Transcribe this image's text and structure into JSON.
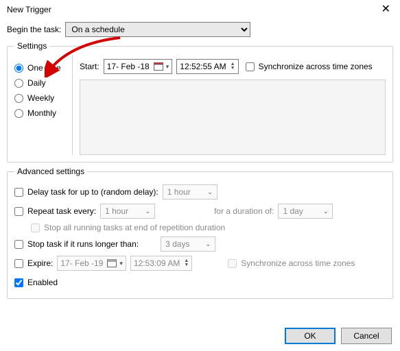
{
  "window": {
    "title": "New Trigger"
  },
  "begin": {
    "label": "Begin the task:",
    "selected": "On a schedule"
  },
  "settings": {
    "legend": "Settings",
    "radios": {
      "one_time": "One time",
      "daily": "Daily",
      "weekly": "Weekly",
      "monthly": "Monthly"
    },
    "start_label": "Start:",
    "date": "17- Feb -18",
    "time": "12:52:55 AM",
    "sync_label": "Synchronize across time zones"
  },
  "advanced": {
    "legend": "Advanced settings",
    "delay_label": "Delay task for up to (random delay):",
    "delay_value": "1 hour",
    "repeat_label": "Repeat task every:",
    "repeat_value": "1 hour",
    "duration_label": "for a duration of:",
    "duration_value": "1 day",
    "stop_all_label": "Stop all running tasks at end of repetition duration",
    "stop_if_label": "Stop task if it runs longer than:",
    "stop_if_value": "3 days",
    "expire_label": "Expire:",
    "expire_date": "17- Feb -19",
    "expire_time": "12:53:09 AM",
    "expire_sync_label": "Synchronize across time zones",
    "enabled_label": "Enabled"
  },
  "buttons": {
    "ok": "OK",
    "cancel": "Cancel"
  }
}
